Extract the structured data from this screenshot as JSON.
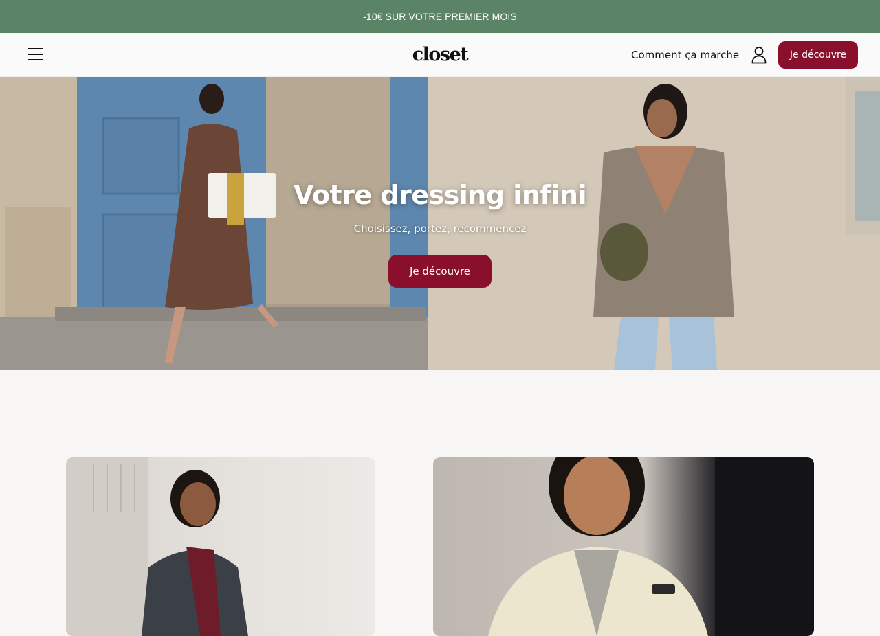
{
  "promo": {
    "text": "-10€ SUR VOTRE PREMIER MOIS"
  },
  "header": {
    "logo": "closet",
    "how_it_works": "Comment ça marche",
    "cta": "Je découvre"
  },
  "hero": {
    "title": "Votre dressing infini",
    "subtitle": "Choisissez, portez, recommencez",
    "cta": "Je découvre"
  },
  "colors": {
    "promo_bg": "#5b8466",
    "brand_burgundy": "#8a0f2c",
    "page_bg": "#f8f5f5"
  },
  "icons": {
    "menu": "hamburger-menu-icon",
    "account": "user-icon"
  }
}
